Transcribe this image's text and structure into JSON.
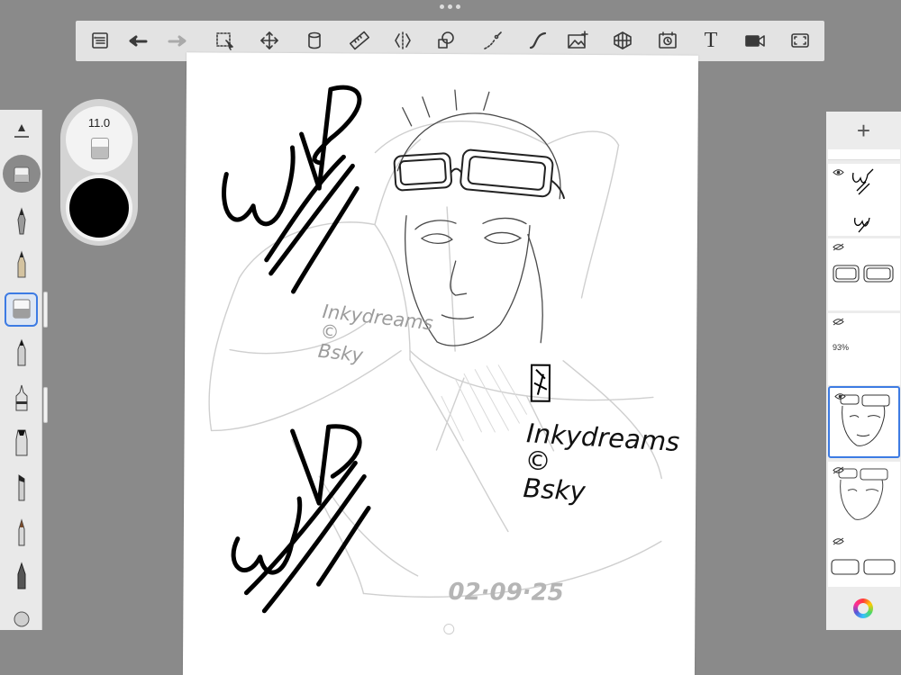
{
  "toolbar": {
    "tools": [
      {
        "name": "menu-icon"
      },
      {
        "name": "undo-icon"
      },
      {
        "name": "redo-icon"
      },
      {
        "name": "selection-icon"
      },
      {
        "name": "transform-icon"
      },
      {
        "name": "fill-icon"
      },
      {
        "name": "ruler-icon"
      },
      {
        "name": "symmetry-icon"
      },
      {
        "name": "shapes-icon"
      },
      {
        "name": "stroke-icon"
      },
      {
        "name": "curve-icon"
      },
      {
        "name": "image-icon"
      },
      {
        "name": "perspective-icon"
      },
      {
        "name": "time-lapse-icon"
      },
      {
        "name": "text-icon",
        "label": "T"
      },
      {
        "name": "video-icon"
      },
      {
        "name": "fullscreen-icon"
      }
    ]
  },
  "brush_settings": {
    "size_value": "11.0",
    "current_color": "#000000"
  },
  "canvas": {
    "watermark_gray": "Inkydreams\n©\nBsky",
    "watermark_black": "Inkydreams\n©\nBsky",
    "date_stamp": "02·09·25",
    "wip_marks": [
      "WIP",
      "WIP"
    ]
  },
  "layers_panel": {
    "add_label": "+",
    "layers": [
      {
        "visible": true,
        "opacity": "",
        "selected": false
      },
      {
        "visible": false,
        "opacity": "",
        "selected": false
      },
      {
        "visible": false,
        "opacity": "93%",
        "selected": false
      },
      {
        "visible": true,
        "opacity": "",
        "selected": true
      },
      {
        "visible": false,
        "opacity": "",
        "selected": false
      },
      {
        "visible": false,
        "opacity": "",
        "selected": false
      }
    ]
  },
  "colors": {
    "accent": "#3d7be3",
    "background": "#8a8a8a"
  }
}
